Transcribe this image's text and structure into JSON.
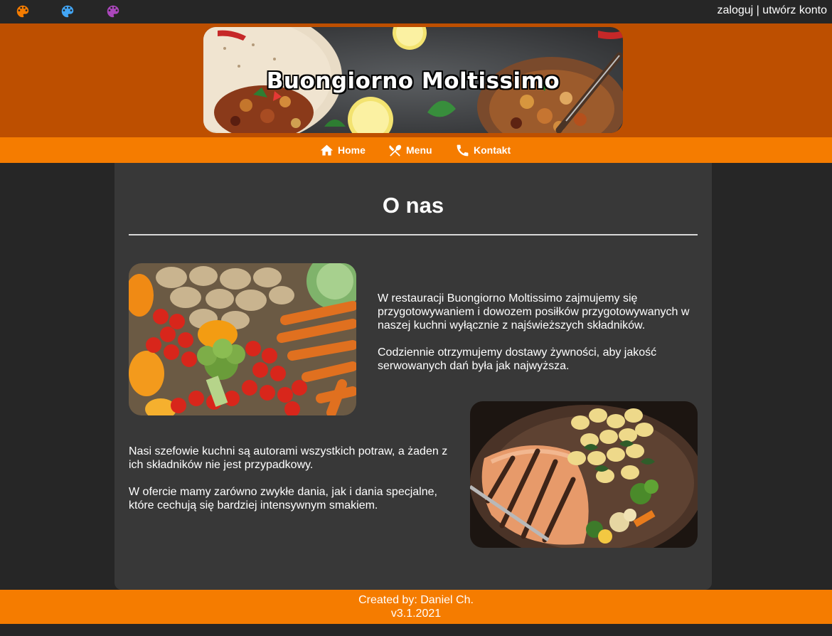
{
  "topbar": {
    "themes": [
      {
        "name": "orange-theme",
        "color": "#f57c00"
      },
      {
        "name": "blue-theme",
        "color": "#42a5f5"
      },
      {
        "name": "purple-theme",
        "color": "#ab47bc"
      }
    ],
    "login_label": "zaloguj",
    "separator": " | ",
    "register_label": "utwórz konto"
  },
  "header": {
    "title": "Buongiorno Moltissimo",
    "bg_color": "#bd4f00"
  },
  "nav": {
    "items": [
      {
        "label": "Home",
        "icon": "home-icon"
      },
      {
        "label": "Menu",
        "icon": "cutlery-icon"
      },
      {
        "label": "Kontakt",
        "icon": "phone-icon"
      }
    ],
    "bg_color": "#f57c00"
  },
  "main": {
    "title": "O nas",
    "paragraphs": [
      "W restauracji Buongiorno Moltissimo zajmujemy się przygotowywaniem i dowozem posiłków przygotowywanych w naszej kuchni wyłącznie z najświeższych składników.",
      "Codziennie otrzymujemy dostawy żywności, aby jakość serwowanych dań była jak najwyższa.",
      "Nasi szefowie kuchni są autorami wszystkich potraw, a żaden z ich składników nie jest przypadkowy.",
      "W ofercie mamy zarówno zwykłe dania, jak i dania specjalne, które cechują się bardziej intensywnym smakiem."
    ]
  },
  "footer": {
    "created_by": "Created by: Daniel Ch.",
    "version": "v3.1.2021"
  }
}
